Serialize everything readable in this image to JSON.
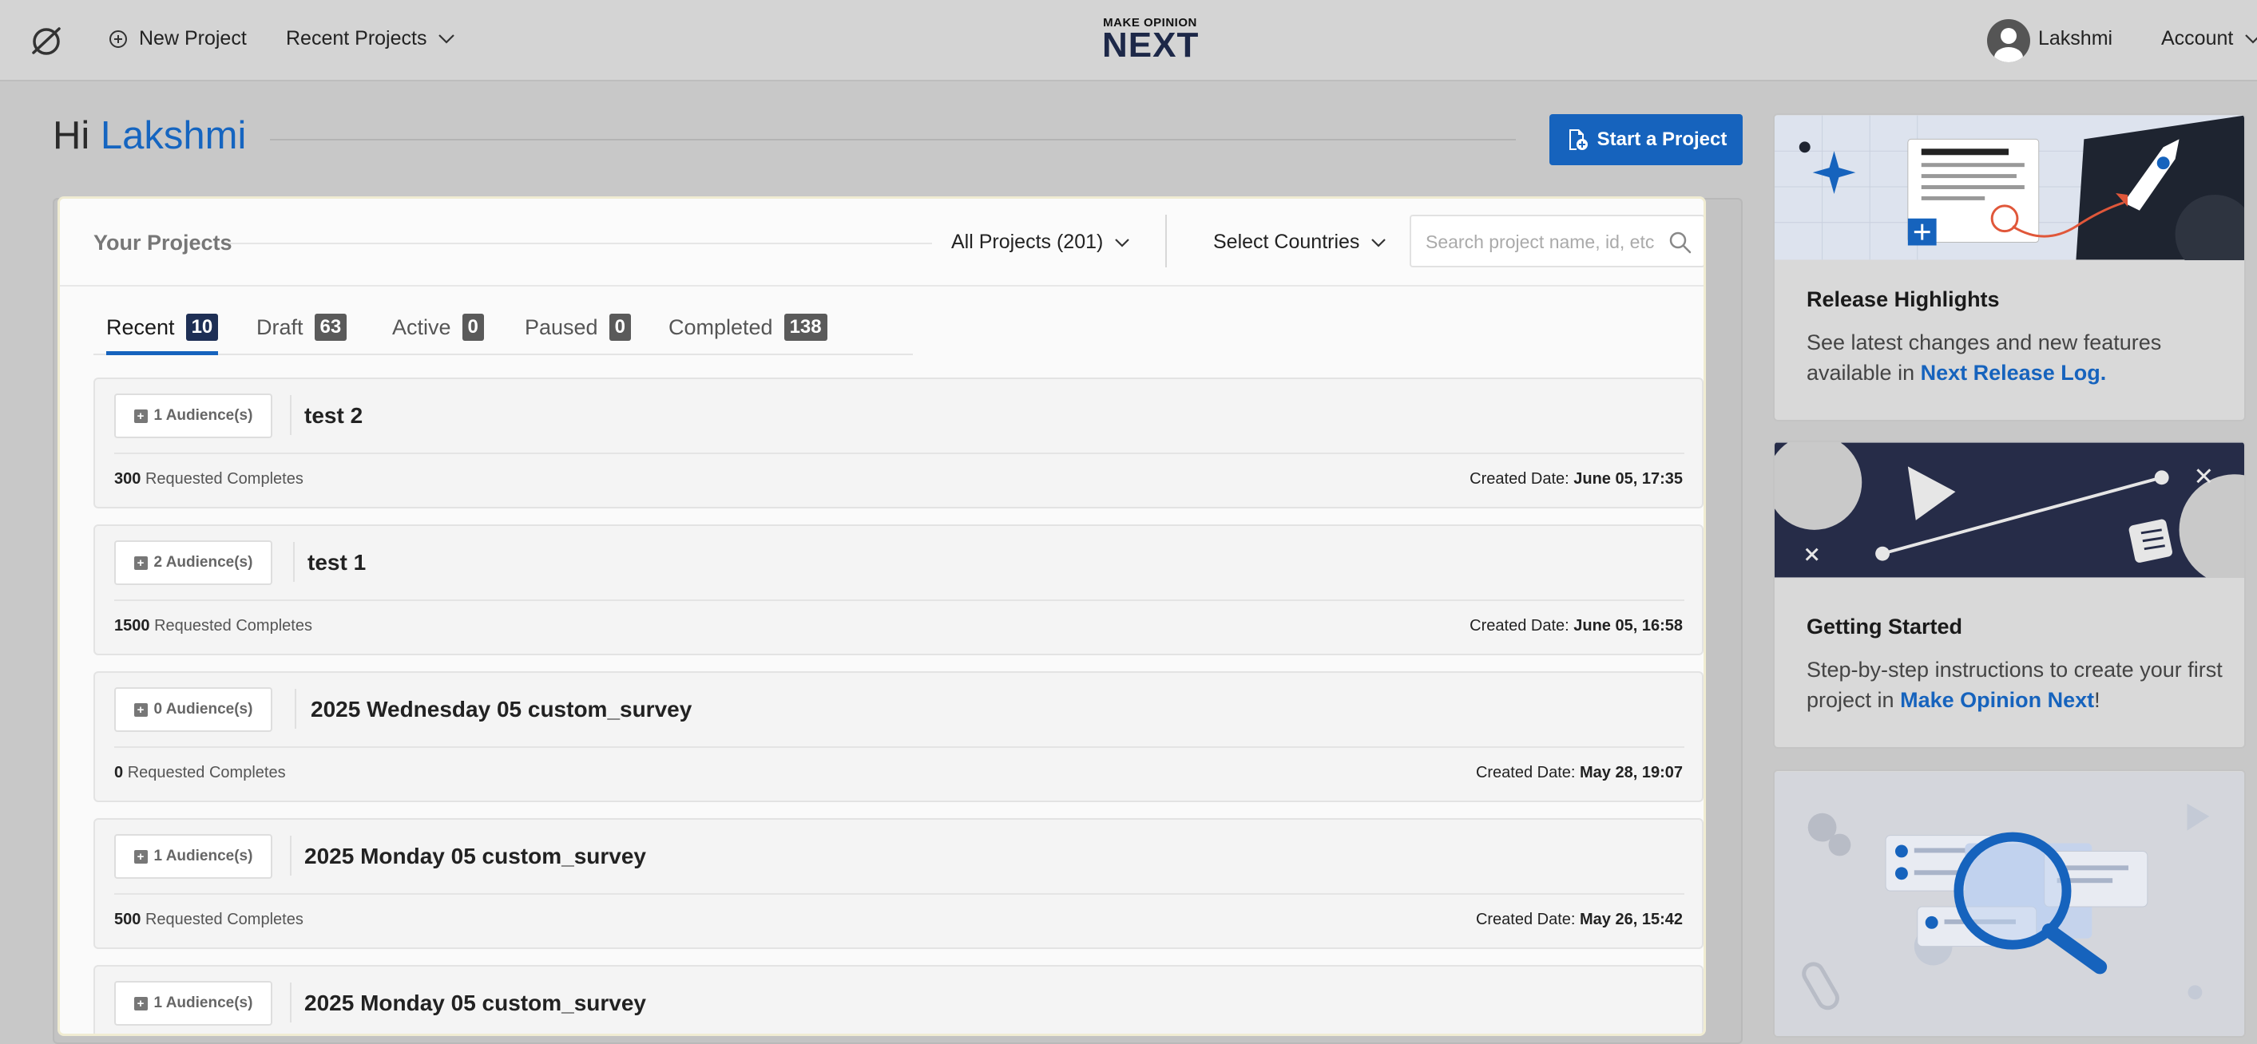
{
  "nav": {
    "new_project": "New Project",
    "recent_projects": "Recent Projects",
    "brand_small": "MAKE OPINION",
    "brand_big": "NEXT",
    "user_name": "Lakshmi",
    "account": "Account"
  },
  "greeting": {
    "hi": "Hi",
    "name": "Lakshmi",
    "start_button": "Start a Project"
  },
  "projects": {
    "heading": "Your Projects",
    "filter_all": "All Projects (201)",
    "filter_countries": "Select Countries",
    "search_placeholder": "Search project name, id, etc",
    "tabs": [
      {
        "label": "Recent",
        "count": "10"
      },
      {
        "label": "Draft",
        "count": "63"
      },
      {
        "label": "Active",
        "count": "0"
      },
      {
        "label": "Paused",
        "count": "0"
      },
      {
        "label": "Completed",
        "count": "138"
      }
    ],
    "requested_label": "Requested Completes",
    "created_label": "Created Date:",
    "cards": [
      {
        "audience": "1 Audience(s)",
        "title": "test 2",
        "requested": "300",
        "created": "June 05, 17:35"
      },
      {
        "audience": "2 Audience(s)",
        "title": "test 1",
        "requested": "1500",
        "created": "June 05, 16:58"
      },
      {
        "audience": "0 Audience(s)",
        "title": "2025 Wednesday 05 custom_survey",
        "requested": "0",
        "created": "May 28, 19:07"
      },
      {
        "audience": "1 Audience(s)",
        "title": "2025 Monday 05 custom_survey",
        "requested": "500",
        "created": "May 26, 15:42"
      },
      {
        "audience": "1 Audience(s)",
        "title": "2025 Monday 05 custom_survey",
        "requested": "",
        "created": ""
      }
    ]
  },
  "sidebar": {
    "release": {
      "title": "Release Highlights",
      "text": "See latest changes and new features available in",
      "link": "Next Release Log."
    },
    "getting_started": {
      "title": "Getting Started",
      "text": "Step-by-step instructions to create your first project in",
      "link": "Make Opinion Next",
      "suffix": "!"
    }
  },
  "colors": {
    "accent": "#1663bd",
    "navy": "#1e2f55"
  }
}
